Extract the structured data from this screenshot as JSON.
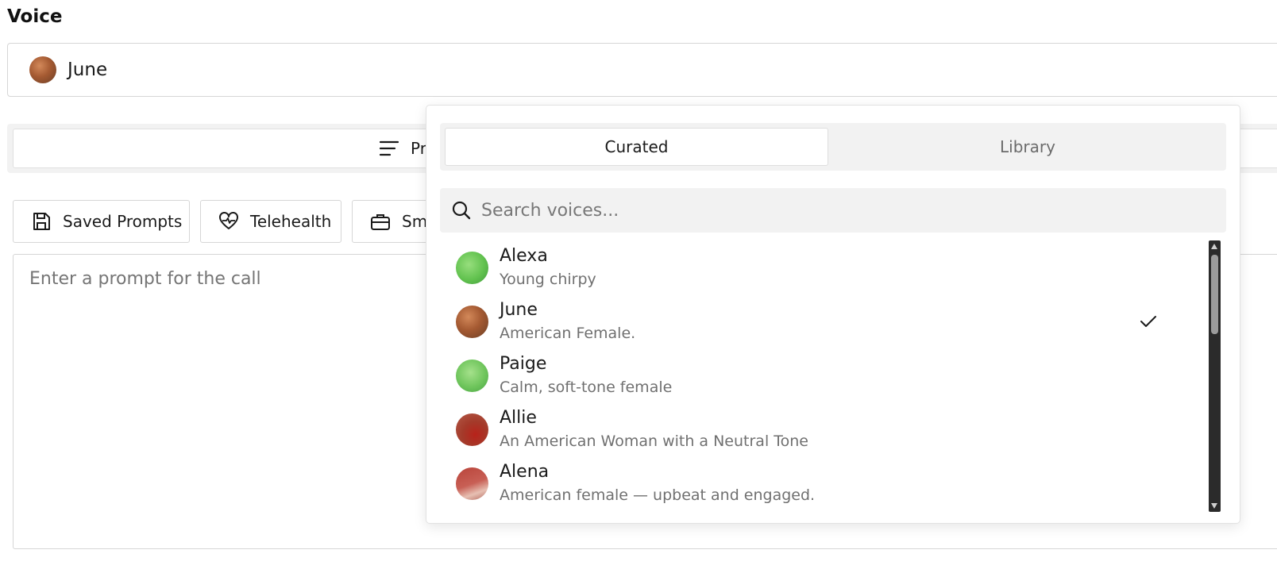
{
  "voice_field": {
    "label": "Voice",
    "selected_name": "June",
    "selected_avatar": "june"
  },
  "mode_tab": {
    "visible_label": "Pro"
  },
  "presets": [
    {
      "label": "Saved Prompts",
      "icon": "save-icon"
    },
    {
      "label": "Telehealth",
      "icon": "heart-pulse-icon"
    },
    {
      "label": "Sm",
      "icon": "briefcase-icon"
    }
  ],
  "prompt": {
    "placeholder": "Enter a prompt for the call"
  },
  "dropdown": {
    "tabs": [
      "Curated",
      "Library"
    ],
    "active_tab": "Curated",
    "search_placeholder": "Search voices...",
    "voices": [
      {
        "name": "Alexa",
        "description": "Young chirpy",
        "avatar": "alexa",
        "selected": false
      },
      {
        "name": "June",
        "description": "American Female.",
        "avatar": "june",
        "selected": true
      },
      {
        "name": "Paige",
        "description": "Calm, soft-tone female",
        "avatar": "paige",
        "selected": false
      },
      {
        "name": "Allie",
        "description": "An American Woman with a Neutral Tone",
        "avatar": "allie",
        "selected": false
      },
      {
        "name": "Alena",
        "description": "American female — upbeat and engaged.",
        "avatar": "alena",
        "selected": false
      }
    ]
  }
}
